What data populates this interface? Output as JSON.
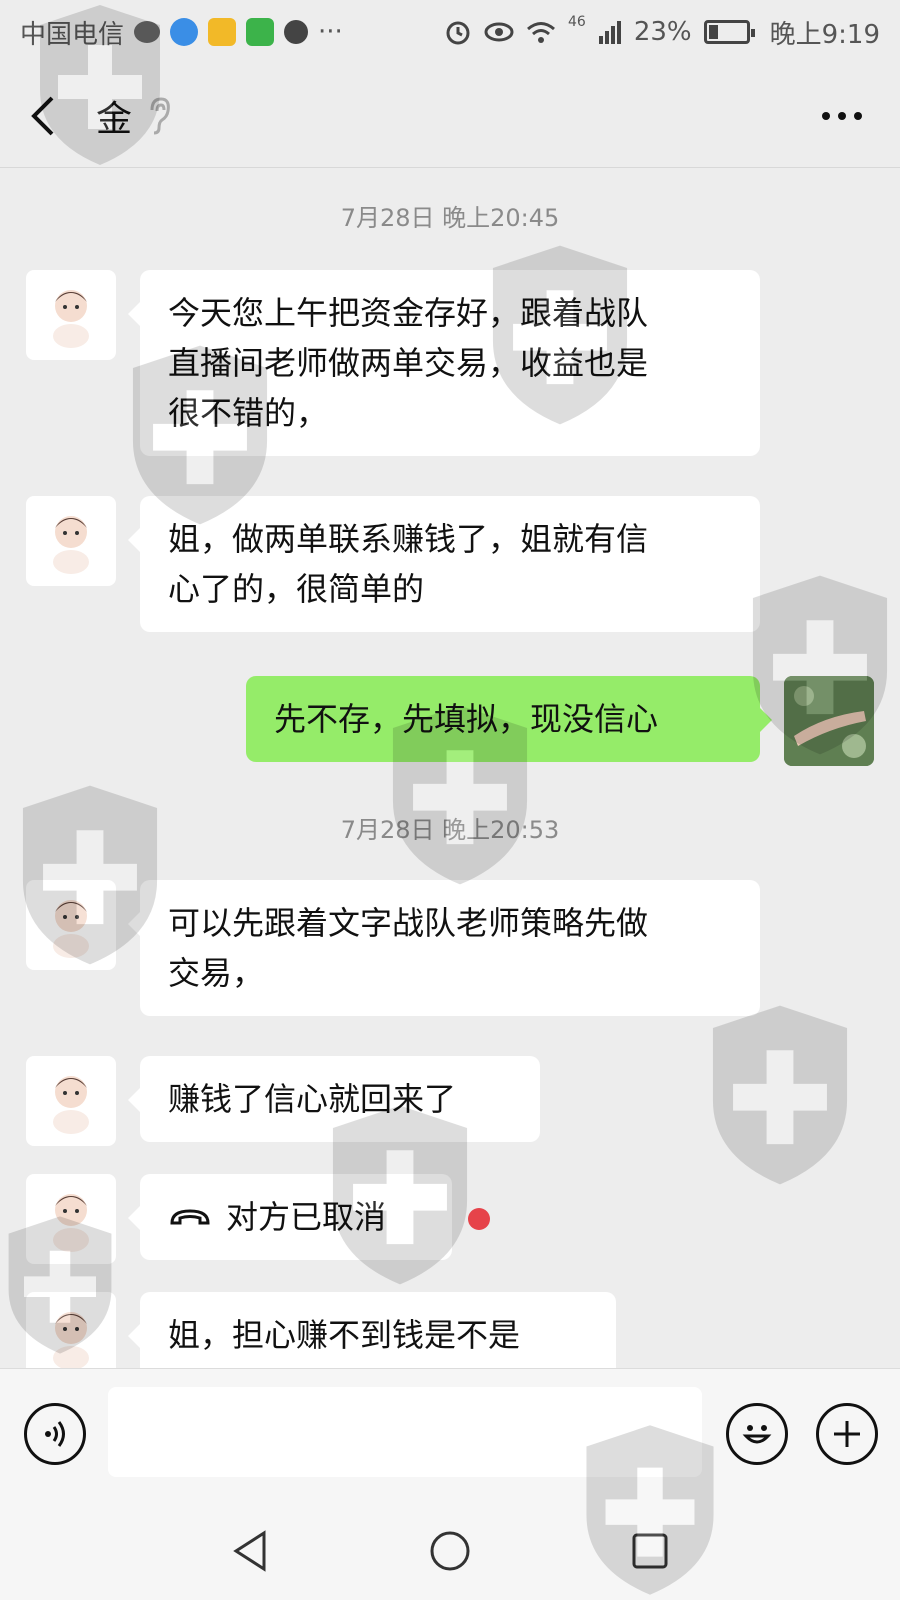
{
  "status_bar": {
    "carrier": "中国电信",
    "misc": "···",
    "network": "46",
    "battery": "23%",
    "time": "晚上9:19"
  },
  "header": {
    "title": "金"
  },
  "messages": [
    {
      "type": "timestamp",
      "text": "7月28日 晚上20:45"
    },
    {
      "type": "left",
      "lines": [
        "今天您上午把资金存好，跟着战队",
        "直播间老师做两单交易，收益也是",
        "很不错的，"
      ]
    },
    {
      "type": "left",
      "lines": [
        "姐，做两单联系赚钱了，姐就有信",
        "心了的，很简单的"
      ]
    },
    {
      "type": "right",
      "lines": [
        "先不存，先填拟，现没信心"
      ]
    },
    {
      "type": "timestamp",
      "text": "7月28日 晚上20:53"
    },
    {
      "type": "left",
      "lines": [
        "可以先跟着文字战队老师策略先做",
        "交易，"
      ]
    },
    {
      "type": "left",
      "lines": [
        "赚钱了信心就回来了"
      ]
    },
    {
      "type": "call",
      "text": "对方已取消"
    },
    {
      "type": "left",
      "lines": [
        "姐，担心赚不到钱是不是"
      ]
    }
  ],
  "input": {
    "value": "",
    "placeholder": ""
  },
  "colors": {
    "background": "#ededed",
    "sent_bubble": "#95ec69",
    "received_bubble": "#ffffff",
    "unread_dot": "#e6434a"
  }
}
